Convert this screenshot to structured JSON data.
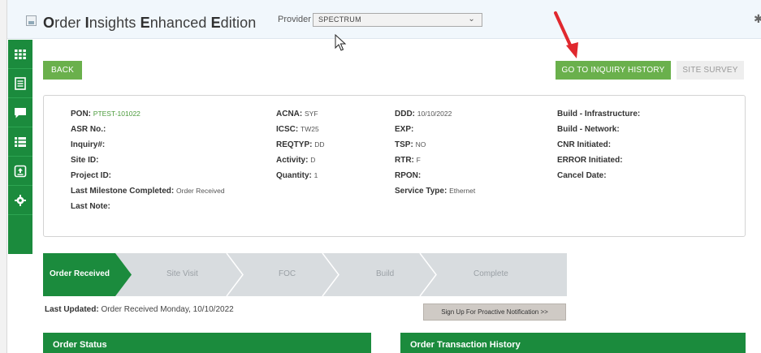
{
  "header": {
    "title_parts": [
      {
        "initial": "O",
        "rest": "rder "
      },
      {
        "initial": "I",
        "rest": "nsights "
      },
      {
        "initial": "E",
        "rest": "nhanced "
      },
      {
        "initial": "E",
        "rest": "dition"
      }
    ],
    "provider_label": "Provider",
    "provider_value": "SPECTRUM"
  },
  "sidebar": {
    "items": [
      {
        "icon": "grid-icon"
      },
      {
        "icon": "document-list-icon"
      },
      {
        "icon": "chat-icon"
      },
      {
        "icon": "list-icon"
      },
      {
        "icon": "upload-icon"
      },
      {
        "icon": "gear-icon"
      }
    ]
  },
  "buttons": {
    "back": "BACK",
    "inquiry_history": "GO TO INQUIRY HISTORY",
    "site_survey": "SITE SURVEY"
  },
  "details": {
    "col1": [
      {
        "label": "PON:",
        "value": "PTEST-101022"
      },
      {
        "label": "ASR No.:",
        "value": ""
      },
      {
        "label": "Inquiry#:",
        "value": ""
      },
      {
        "label": "Site ID:",
        "value": ""
      },
      {
        "label": "Project ID:",
        "value": ""
      },
      {
        "label": "Last Milestone Completed:",
        "value": "Order Received"
      },
      {
        "label": "Last Note:",
        "value": ""
      }
    ],
    "col2": [
      {
        "label": "ACNA:",
        "value": "SYF"
      },
      {
        "label": "ICSC:",
        "value": "TW25"
      },
      {
        "label": "REQTYP:",
        "value": "DD"
      },
      {
        "label": "Activity:",
        "value": "D"
      },
      {
        "label": "Quantity:",
        "value": "1"
      }
    ],
    "col3": [
      {
        "label": "DDD:",
        "value": "10/10/2022"
      },
      {
        "label": "EXP:",
        "value": ""
      },
      {
        "label": "TSP:",
        "value": "NO"
      },
      {
        "label": "RTR:",
        "value": "F"
      },
      {
        "label": "RPON:",
        "value": ""
      },
      {
        "label": "Service Type:",
        "value": "Ethernet"
      }
    ],
    "col4": [
      {
        "label": "Build - Infrastructure:",
        "value": ""
      },
      {
        "label": "Build - Network:",
        "value": ""
      },
      {
        "label": "CNR Initiated:",
        "value": ""
      },
      {
        "label": "ERROR Initiated:",
        "value": ""
      },
      {
        "label": "Cancel Date:",
        "value": ""
      }
    ]
  },
  "progress": {
    "steps": [
      "Order Received",
      "Site Visit",
      "FOC",
      "Build",
      "Complete"
    ],
    "active_index": 0
  },
  "status": {
    "last_updated_label": "Last Updated:",
    "last_updated_value": "Order Received Monday, 10/10/2022",
    "signup_label": "Sign Up For Proactive Notification >>"
  },
  "panels": {
    "order_status": "Order Status",
    "order_transaction_history": "Order Transaction History"
  },
  "colors": {
    "primary_green": "#1b8b3d",
    "button_green": "#6ab04c",
    "annotation_red": "#e0282e"
  }
}
